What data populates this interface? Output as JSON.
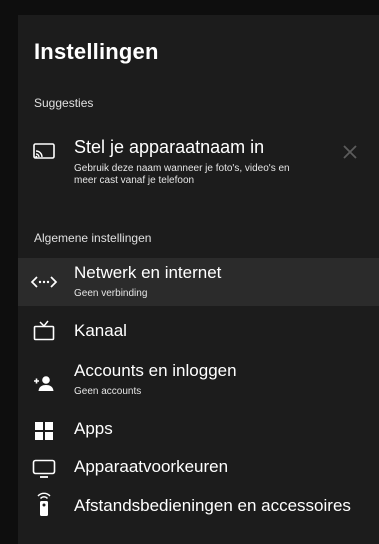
{
  "page": {
    "title": "Instellingen"
  },
  "suggestions": {
    "header": "Suggesties",
    "item": {
      "label": "Stel je apparaatnaam in",
      "sub": "Gebruik deze naam wanneer je foto's, video's en meer cast vanaf je telefoon",
      "icon": "cast-icon"
    }
  },
  "general": {
    "header": "Algemene instellingen",
    "items": [
      {
        "label": "Netwerk en internet",
        "sub": "Geen verbinding",
        "icon": "network-icon"
      },
      {
        "label": "Kanaal",
        "icon": "tv-icon"
      },
      {
        "label": "Accounts en inloggen",
        "sub": "Geen accounts",
        "icon": "add-account-icon"
      },
      {
        "label": "Apps",
        "icon": "apps-icon"
      },
      {
        "label": "Apparaatvoorkeuren",
        "icon": "display-icon"
      },
      {
        "label": "Afstandsbedieningen en accessoires",
        "icon": "remote-icon"
      }
    ]
  },
  "colors": {
    "background": "#0e0e0e",
    "panel": "#1c1c1c",
    "highlight": "#2b2b2b",
    "text": "#ffffff"
  }
}
